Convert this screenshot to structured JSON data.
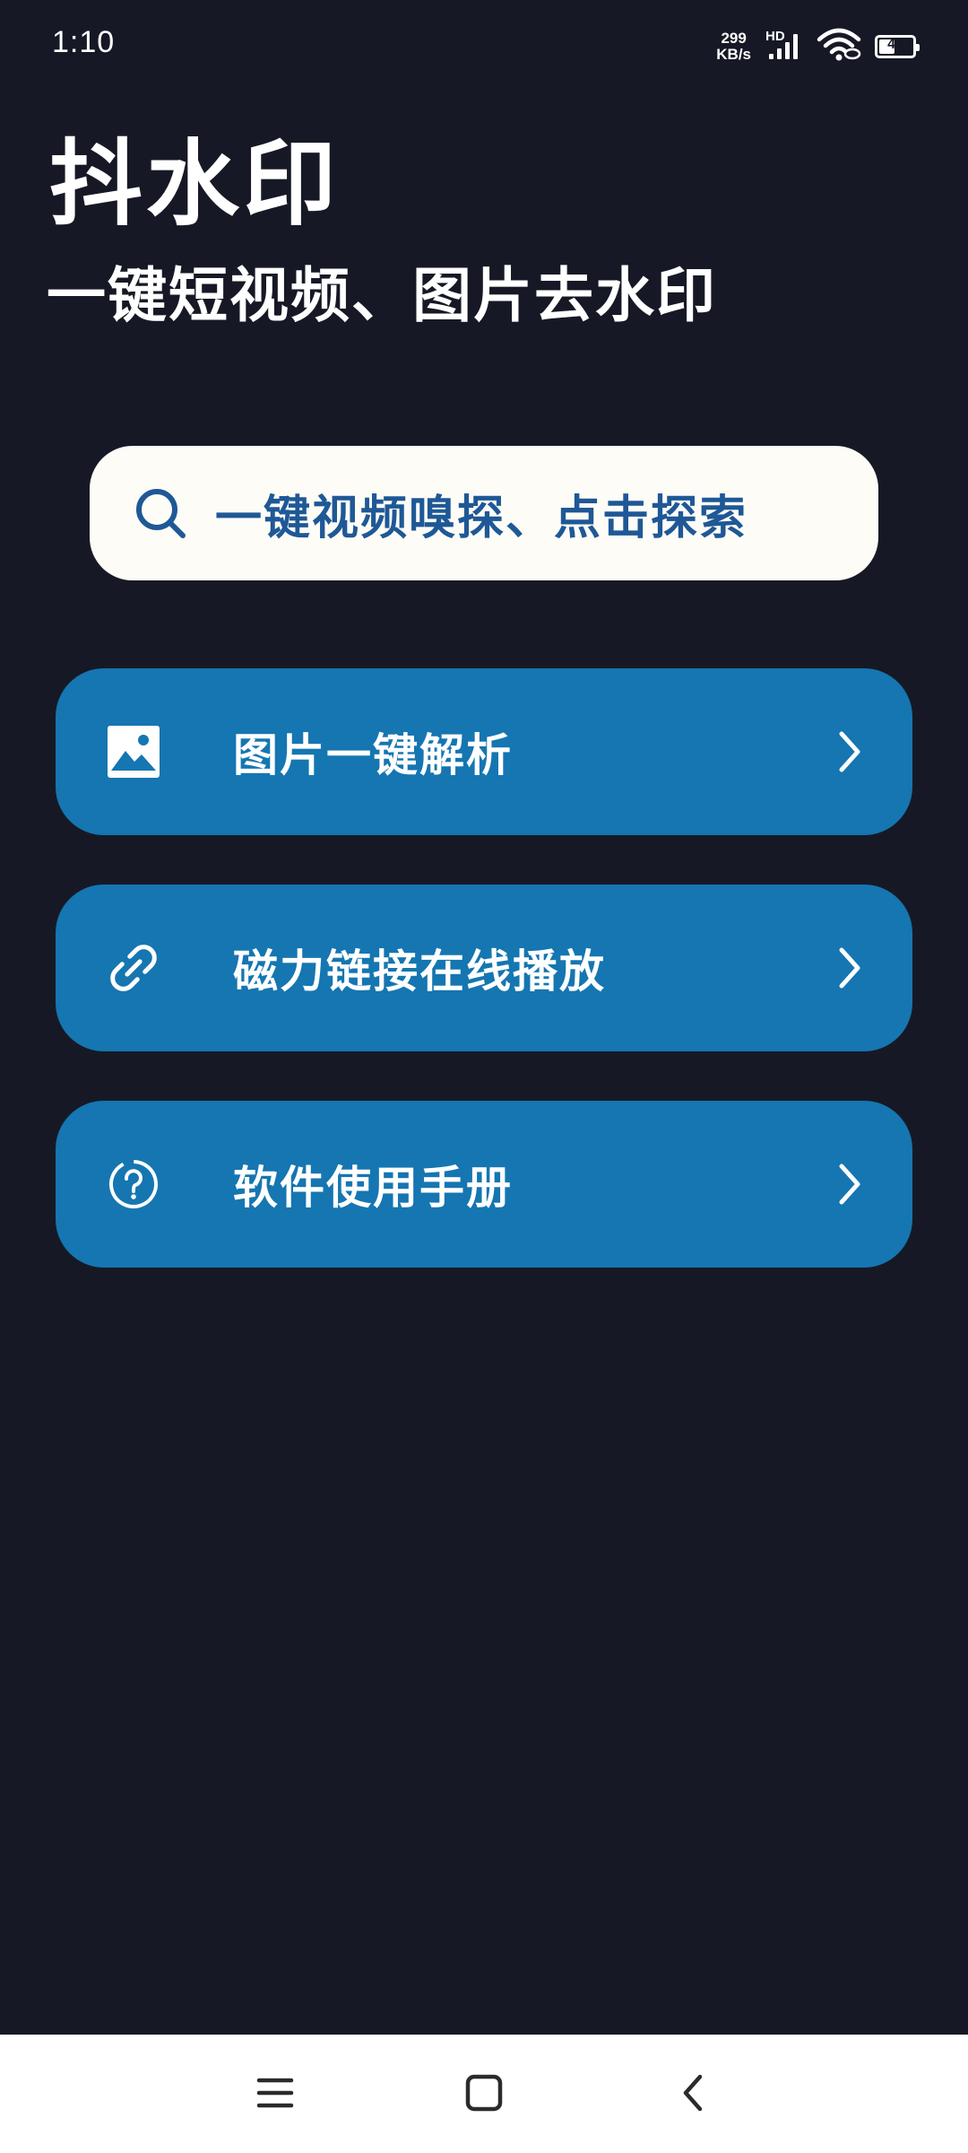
{
  "status_bar": {
    "time": "1:10",
    "net_speed_value": "299",
    "net_speed_unit": "KB/s",
    "network_type": "HD",
    "battery_level": "42",
    "icons": [
      "signal-icon",
      "wifi-icon",
      "battery-icon"
    ]
  },
  "header": {
    "title": "抖水印",
    "subtitle": "一键短视频、图片去水印"
  },
  "search": {
    "label": "一键视频嗅探、点击探索",
    "icon": "search-icon"
  },
  "menu": [
    {
      "label": "图片一键解析",
      "icon": "image-icon"
    },
    {
      "label": "磁力链接在线播放",
      "icon": "link-icon"
    },
    {
      "label": "软件使用手册",
      "icon": "help-circle-icon"
    }
  ],
  "colors": {
    "background": "#161925",
    "card": "#1576b1",
    "search_background": "#fdfcf7",
    "search_text": "#1f5896",
    "nav_background": "#ffffff"
  },
  "nav_bar": {
    "buttons": [
      "menu-icon",
      "home-icon",
      "back-icon"
    ]
  }
}
